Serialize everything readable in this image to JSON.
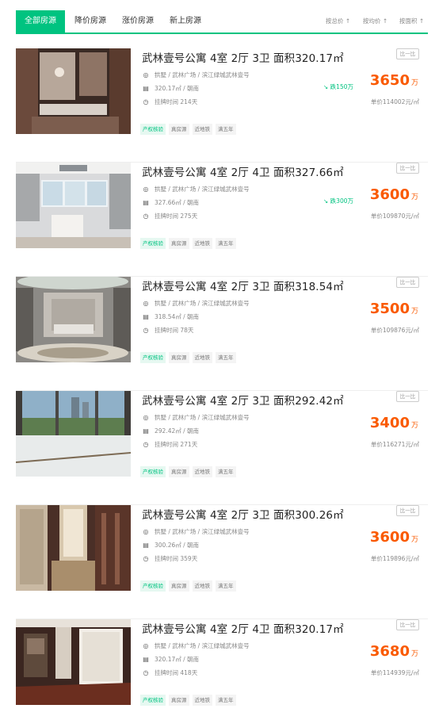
{
  "tabs": [
    {
      "label": "全部房源"
    },
    {
      "label": "降价房源"
    },
    {
      "label": "涨价房源"
    },
    {
      "label": "新上房源"
    }
  ],
  "sort": {
    "total": "按总价 ↑",
    "unit": "按均价 ↑",
    "area": "按面积 ↑"
  },
  "compare_label": "比一比",
  "icons": {
    "location": "location-pin-icon",
    "layout": "floorplan-icon",
    "time": "clock-icon",
    "drop": "trend-down-icon"
  },
  "colors": {
    "accent": "#00c380",
    "price": "#fa5a00"
  },
  "listings": [
    {
      "title": "武林壹号公寓 4室 2厅 3卫 面积320.17㎡",
      "location": "拱墅 / 武林广场 / 滨江绿城武林壹号",
      "layout": "320.17㎡ / 朝南",
      "listed": "挂牌时间 214天",
      "drop": "跌150万",
      "price": "3650",
      "price_unit": "万",
      "unit_price": "单价114002元/㎡",
      "tags": [
        "产权核验",
        "真房源",
        "近地铁",
        "满五年"
      ]
    },
    {
      "title": "武林壹号公寓 4室 2厅 4卫 面积327.66㎡",
      "location": "拱墅 / 武林广场 / 滨江绿城武林壹号",
      "layout": "327.66㎡ / 朝南",
      "listed": "挂牌时间 275天",
      "drop": "跌300万",
      "price": "3600",
      "price_unit": "万",
      "unit_price": "单价109870元/㎡",
      "tags": [
        "产权核验",
        "真房源",
        "近地铁",
        "满五年"
      ]
    },
    {
      "title": "武林壹号公寓 4室 2厅 3卫 面积318.54㎡",
      "location": "拱墅 / 武林广场 / 滨江绿城武林壹号",
      "layout": "318.54㎡ / 朝南",
      "listed": "挂牌时间 78天",
      "drop": "",
      "price": "3500",
      "price_unit": "万",
      "unit_price": "单价109876元/㎡",
      "tags": [
        "产权核验",
        "真房源",
        "近地铁",
        "满五年"
      ]
    },
    {
      "title": "武林壹号公寓 4室 2厅 3卫 面积292.42㎡",
      "location": "拱墅 / 武林广场 / 滨江绿城武林壹号",
      "layout": "292.42㎡ / 朝南",
      "listed": "挂牌时间 271天",
      "drop": "",
      "price": "3400",
      "price_unit": "万",
      "unit_price": "单价116271元/㎡",
      "tags": [
        "产权核验",
        "真房源",
        "近地铁",
        "满五年"
      ]
    },
    {
      "title": "武林壹号公寓 4室 2厅 3卫 面积300.26㎡",
      "location": "拱墅 / 武林广场 / 滨江绿城武林壹号",
      "layout": "300.26㎡ / 朝南",
      "listed": "挂牌时间 359天",
      "drop": "",
      "price": "3600",
      "price_unit": "万",
      "unit_price": "单价119896元/㎡",
      "tags": [
        "产权核验",
        "真房源",
        "近地铁",
        "满五年"
      ]
    },
    {
      "title": "武林壹号公寓 4室 2厅 4卫 面积320.17㎡",
      "location": "拱墅 / 武林广场 / 滨江绿城武林壹号",
      "layout": "320.17㎡ / 朝南",
      "listed": "挂牌时间 418天",
      "drop": "",
      "price": "3680",
      "price_unit": "万",
      "unit_price": "单价114939元/㎡",
      "tags": [
        "产权核验",
        "真房源",
        "近地铁",
        "满五年"
      ]
    }
  ]
}
